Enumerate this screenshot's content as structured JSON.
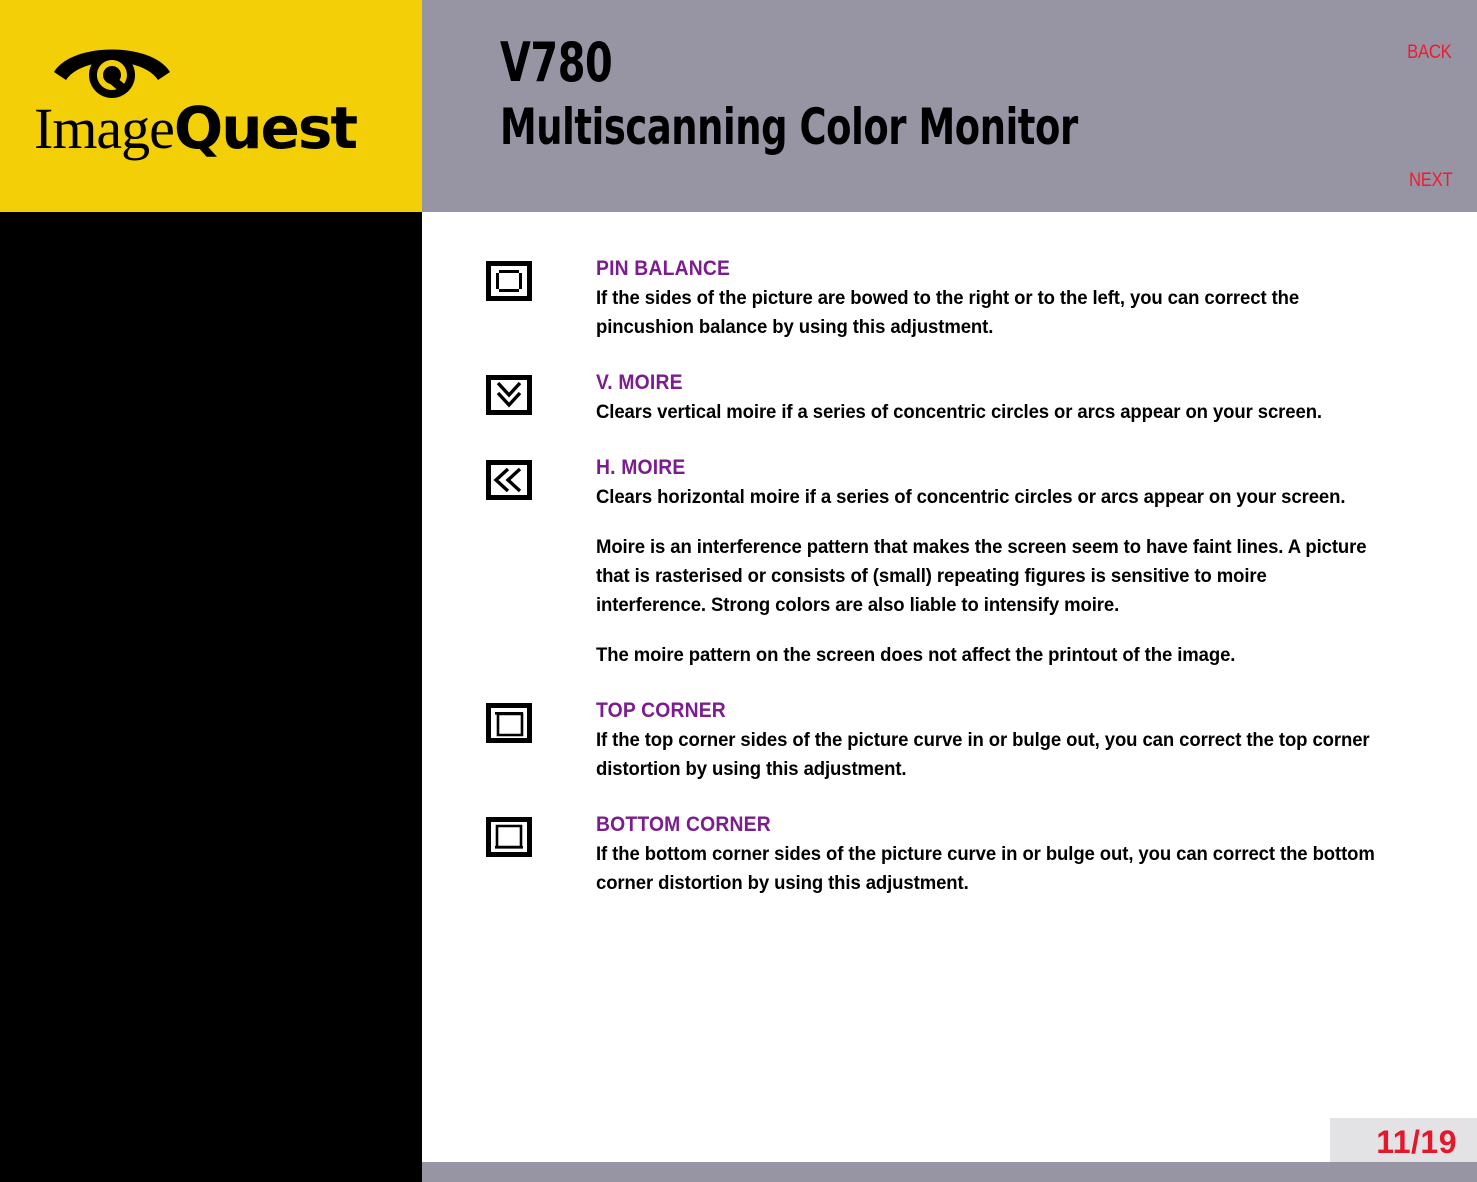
{
  "header": {
    "logo": {
      "mark": "eye-q-logo-mark",
      "word_part1": "Image",
      "word_part2": "Quest"
    },
    "model": "V780",
    "product_name": "Multiscanning Color Monitor",
    "nav": {
      "back_label": "BACK",
      "next_label": "NEXT"
    },
    "colors": {
      "logo_background": "#f2cf06",
      "header_background": "#9795a4",
      "nav_link": "#ee1b2e"
    }
  },
  "content": {
    "entries": [
      {
        "icon": "pin-balance-icon",
        "heading": "PIN BALANCE",
        "paragraphs": [
          "If the sides of the picture are bowed to the right or to the left, you can correct the pincushion balance by using this adjustment."
        ]
      },
      {
        "icon": "v-moire-icon",
        "heading": "V. MOIRE",
        "paragraphs": [
          "Clears vertical moire if a series of concentric circles or arcs appear on your screen."
        ]
      },
      {
        "icon": "h-moire-icon",
        "heading": "H. MOIRE",
        "paragraphs": [
          "Clears horizontal moire if a series of concentric circles or arcs appear on your screen.",
          "Moire is an interference pattern that makes the screen seem to have faint lines. A picture that is rasterised or consists of (small) repeating figures is sensitive to moire interference. Strong colors are also liable to intensify moire.",
          "The moire pattern on the screen does not affect the printout of the image."
        ]
      },
      {
        "icon": "top-corner-icon",
        "heading": "TOP CORNER",
        "paragraphs": [
          "If the top corner sides of the picture curve in or bulge out, you can correct the top corner distortion by using this adjustment."
        ]
      },
      {
        "icon": "bottom-corner-icon",
        "heading": "BOTTOM CORNER",
        "paragraphs": [
          "If the bottom corner sides of the picture curve in or bulge out, you can correct the bottom corner distortion by using this adjustment."
        ]
      }
    ],
    "heading_color": "#7b1d8e"
  },
  "footer": {
    "page_indicator": "11/19",
    "page_indicator_color": "#e4182c",
    "badge_background": "#e3e3e6",
    "bar_background": "#9795a4"
  }
}
